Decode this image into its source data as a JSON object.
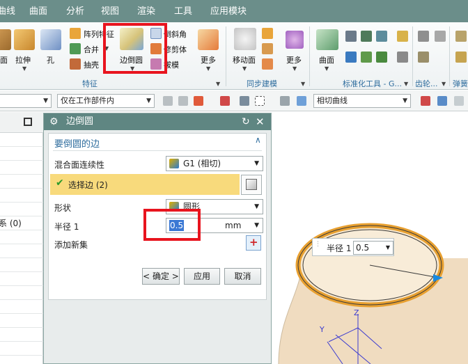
{
  "menu": [
    "曲线",
    "曲面",
    "分析",
    "视图",
    "渲染",
    "工具",
    "应用模块"
  ],
  "ribbon": {
    "left_cut_label": "面",
    "extrude": "拉伸",
    "hole": "孔",
    "pattern_feature": "阵列特征",
    "unite": "合并",
    "shell": "抽壳",
    "edge_blend": "边倒圆",
    "chamfer": "倒斜角",
    "trim_body": "修剪体",
    "draft": "拔模",
    "more1": "更多",
    "move_face": "移动面",
    "more2": "更多",
    "surface": "曲面",
    "group_feature": "特征",
    "group_sync": "同步建模",
    "group_std": "标准化工具 - G...",
    "group_gear": "齿轮...",
    "group_spring": "弹簧"
  },
  "toolbar2": {
    "filter_scope": "仅在工作部件内",
    "curve_rule": "相切曲线"
  },
  "navigator": {
    "row_label": "系 (0)"
  },
  "dialog": {
    "title": "边倒圆",
    "section_title": "要倒圆的边",
    "continuity_label": "混合面连续性",
    "continuity_value": "G1 (相切)",
    "select_edge": "选择边 (2)",
    "shape_label": "形状",
    "shape_value": "圆形",
    "radius_label": "半径 1",
    "radius_value": "0.5",
    "radius_unit": "mm",
    "add_set_label": "添加新集",
    "ok_label": "< 确定 >",
    "apply_label": "应用",
    "cancel_label": "取消"
  },
  "viewport": {
    "onscreen_label": "半径 1",
    "onscreen_value": "0.5",
    "axis_y": "Y",
    "axis_z": "Z"
  },
  "colors": {
    "menubar": "#6b8e8a",
    "dialog_title": "#5f8682",
    "highlight": "#f8da7c",
    "red_marker": "#e8141e",
    "part_body": "#f0dcc0",
    "edge_orange": "#e8a030"
  }
}
